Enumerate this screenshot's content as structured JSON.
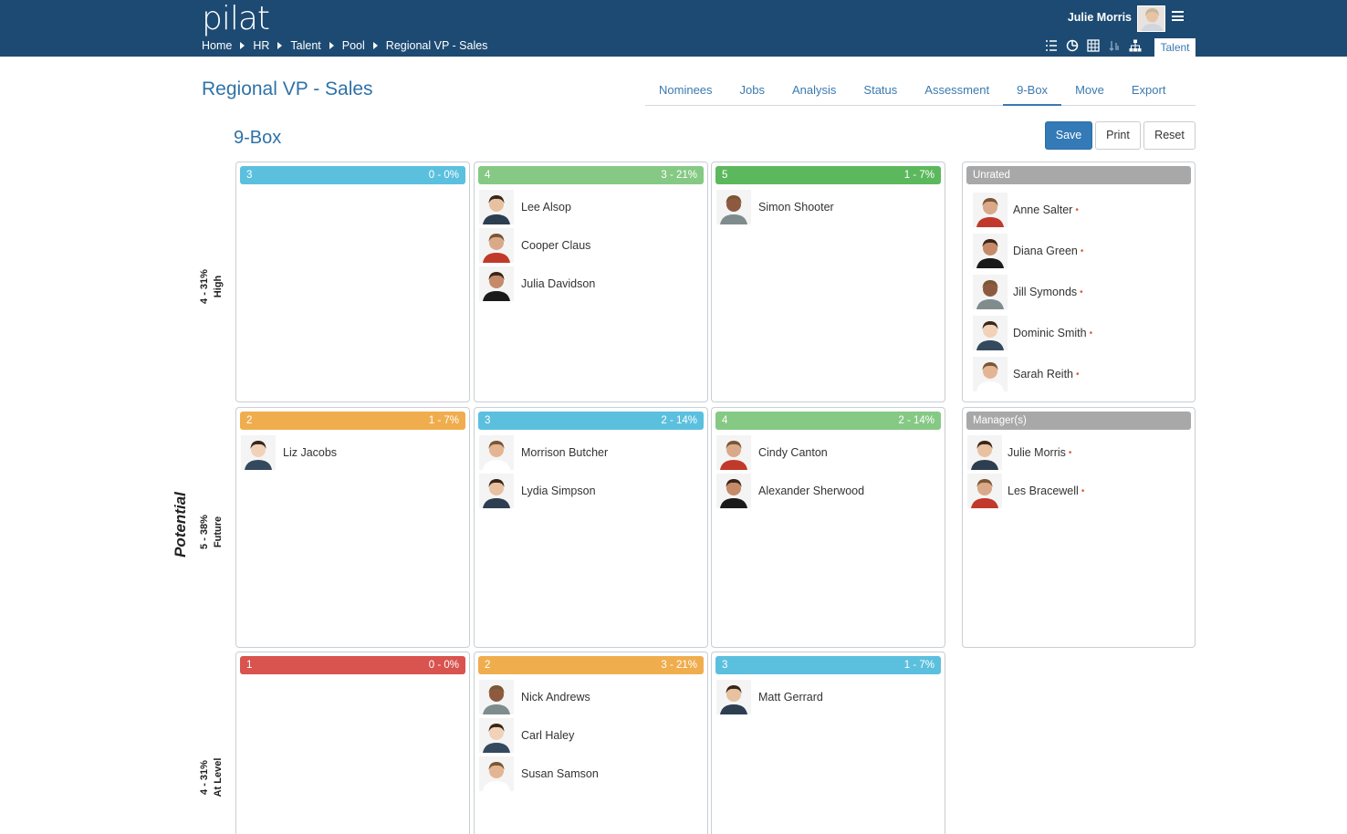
{
  "header": {
    "logo": "pilat",
    "breadcrumb": [
      "Home",
      "HR",
      "Talent",
      "Pool",
      "Regional VP - Sales"
    ],
    "user_name": "Julie Morris",
    "active_section": "Talent"
  },
  "page": {
    "title": "Regional VP - Sales",
    "tabs": [
      {
        "label": "Nominees",
        "active": false
      },
      {
        "label": "Jobs",
        "active": false
      },
      {
        "label": "Analysis",
        "active": false
      },
      {
        "label": "Status",
        "active": false
      },
      {
        "label": "Assessment",
        "active": false
      },
      {
        "label": "9-Box",
        "active": true
      },
      {
        "label": "Move",
        "active": false
      },
      {
        "label": "Export",
        "active": false
      }
    ],
    "subtitle": "9-Box",
    "buttons": {
      "save": "Save",
      "print": "Print",
      "reset": "Reset"
    }
  },
  "grid": {
    "axis_label": "Potential",
    "rows": [
      {
        "count_label": "4 - 31%",
        "name": "High"
      },
      {
        "count_label": "5 - 38%",
        "name": "Future"
      },
      {
        "count_label": "4 - 31%",
        "name": "At Level"
      }
    ],
    "boxes": [
      {
        "num": "3",
        "stat": "0 - 0%",
        "color": "#5bc0de",
        "people": []
      },
      {
        "num": "4",
        "stat": "3 - 21%",
        "color": "#85c985",
        "people": [
          "Lee Alsop",
          "Cooper Claus",
          "Julia Davidson"
        ]
      },
      {
        "num": "5",
        "stat": "1 - 7%",
        "color": "#5cb85c",
        "people": [
          "Simon Shooter"
        ]
      },
      {
        "num": "2",
        "stat": "1 - 7%",
        "color": "#f0ad4e",
        "people": [
          "Liz Jacobs"
        ]
      },
      {
        "num": "3",
        "stat": "2 - 14%",
        "color": "#5bc0de",
        "people": [
          "Morrison Butcher",
          "Lydia Simpson"
        ]
      },
      {
        "num": "4",
        "stat": "2 - 14%",
        "color": "#85c985",
        "people": [
          "Cindy Canton",
          "Alexander Sherwood"
        ]
      },
      {
        "num": "1",
        "stat": "0 - 0%",
        "color": "#d9534f",
        "people": []
      },
      {
        "num": "2",
        "stat": "3 - 21%",
        "color": "#f0ad4e",
        "people": [
          "Nick Andrews",
          "Carl Haley",
          "Susan Samson"
        ]
      },
      {
        "num": "3",
        "stat": "1 - 7%",
        "color": "#5bc0de",
        "people": [
          "Matt Gerrard"
        ]
      }
    ],
    "side_panels": [
      {
        "title": "Unrated",
        "color": "#a8a8a8",
        "people": [
          "Anne Salter",
          "Diana Green",
          "Jill Symonds",
          "Dominic Smith",
          "Sarah Reith"
        ]
      },
      {
        "title": "Manager(s)",
        "color": "#a8a8a8",
        "people": [
          "Julie Morris",
          "Les Bracewell"
        ]
      }
    ]
  }
}
